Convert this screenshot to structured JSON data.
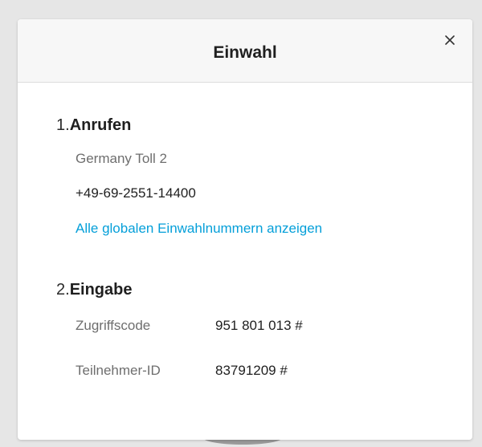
{
  "dialog": {
    "title": "Einwahl",
    "close_icon": "close-icon"
  },
  "call": {
    "number": "1.",
    "heading": "Anrufen",
    "location": "Germany Toll 2",
    "phone": "+49-69-2551-14400",
    "global_link": "Alle globalen Einwahlnummern anzeigen"
  },
  "enter": {
    "number": "2.",
    "heading": "Eingabe",
    "access_code_label": "Zugriffscode",
    "access_code_value": "951 801 013 #",
    "attendee_id_label": "Teilnehmer-ID",
    "attendee_id_value": "83791209 #"
  },
  "colors": {
    "link": "#049fd9",
    "header_bg": "#f7f7f7",
    "backdrop": "#e6e6e6"
  }
}
